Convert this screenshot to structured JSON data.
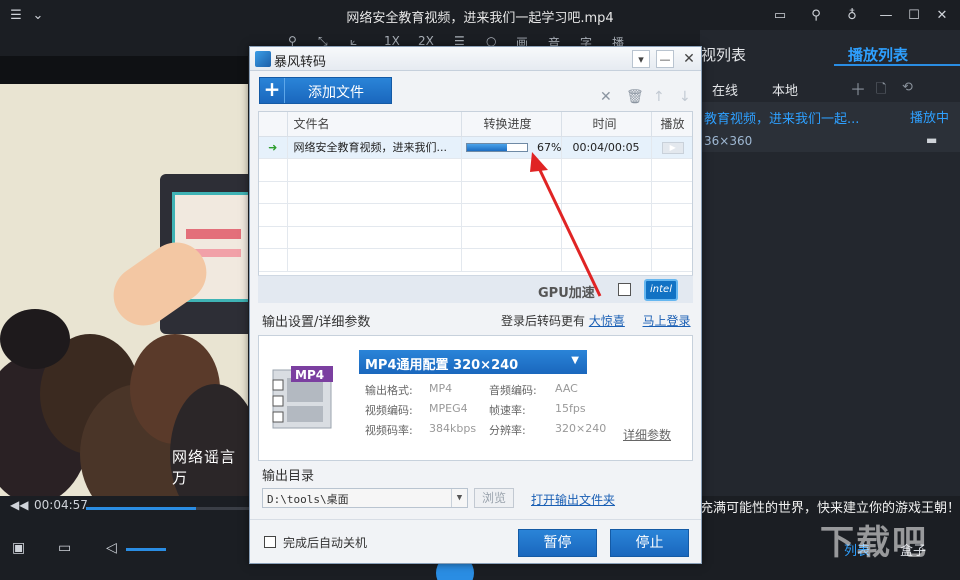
{
  "window": {
    "title": "网络安全教育视频，进来我们一起学习吧.mp4"
  },
  "toolbar": {
    "items": [
      "1X",
      "2X",
      "画",
      "音",
      "字",
      "播"
    ]
  },
  "video": {
    "subtitle": "网络谣言万",
    "current_time": "00:04:57",
    "progress": 0.67
  },
  "playlist": {
    "tab_left": "影视列表",
    "tab_right": "播放列表",
    "sub_online": "在线",
    "sub_local": "本地",
    "item_title": "教育视频，进来我们一起...",
    "item_status": "播放中",
    "item_res": "36×360",
    "marquee": "充满可能性的世界，快来建立你的游戏王朝！",
    "footer_list": "列表",
    "footer_box": "盒子"
  },
  "dialog": {
    "title": "暴风转码",
    "add_file": "添加文件",
    "table": {
      "headers": [
        "文件名",
        "转换进度",
        "时间",
        "播放"
      ],
      "rows": [
        {
          "name": "网络安全教育视频，进来我们...",
          "progress": 0.67,
          "progress_text": "67%",
          "time": "00:04/00:05"
        }
      ]
    },
    "gpu_label": "GPU加速",
    "intel_label": "intel",
    "output_settings": "输出设置/详细参数",
    "login_tip": "登录后转码更有",
    "login_link1": "大惊喜",
    "login_link2": "马上登录",
    "config_name": "MP4通用配置  320×240",
    "format_badge": "MP4",
    "params": {
      "format_label": "输出格式:",
      "format_val": "MP4",
      "acodec_label": "音频编码:",
      "acodec_val": "AAC",
      "vcodec_label": "视频编码:",
      "vcodec_val": "MPEG4",
      "fps_label": "帧速率:",
      "fps_val": "15fps",
      "vbitrate_label": "视频码率:",
      "vbitrate_val": "384kbps",
      "res_label": "分辨率:",
      "res_val": "320×240"
    },
    "detail_link": "详细参数",
    "output_dir_label": "输出目录",
    "output_dir": "D:\\tools\\桌面",
    "browse": "浏览",
    "open_folder": "打开输出文件夹",
    "auto_shutdown": "完成后自动关机",
    "pause": "暂停",
    "stop": "停止"
  },
  "watermark": "下载吧",
  "colors": {
    "accent": "#1a67bd",
    "arrow": "#e02424"
  }
}
